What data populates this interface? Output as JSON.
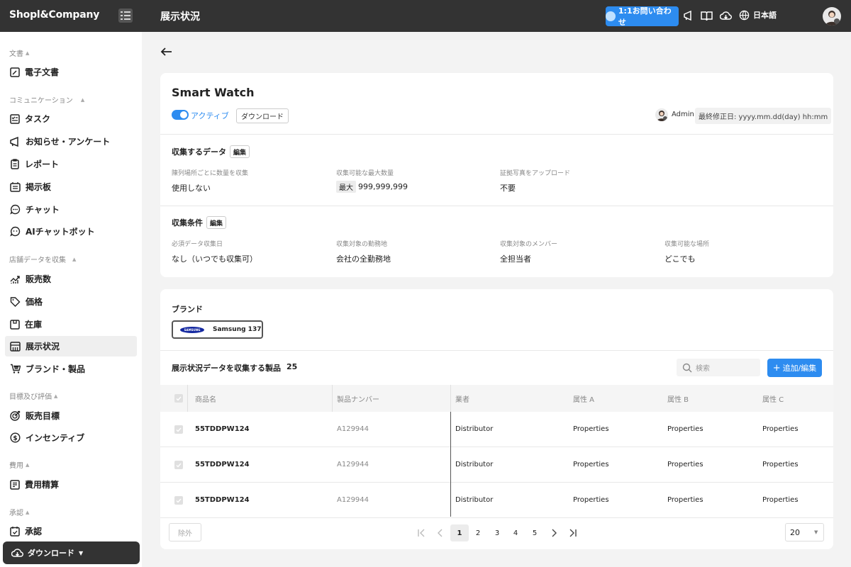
{
  "topbar": {
    "logo": "Shopl&Company",
    "page_title": "展示状況",
    "contact_label": "1:1お問い合わせ",
    "language": "日本語"
  },
  "sidebar": {
    "sections": {
      "documents": "文書",
      "communication": "コミュニケーション",
      "store_data": "店舗データを収集",
      "goals": "目標及び評価",
      "expenses": "費用",
      "approval": "承認"
    },
    "items": {
      "e_document": "電子文書",
      "task": "タスク",
      "notice": "お知らせ・アンケート",
      "report": "レポート",
      "board": "掲示板",
      "chat": "チャット",
      "ai_chatbot": "AIチャットボット",
      "sales": "販売数",
      "price": "価格",
      "stock": "在庫",
      "display": "展示状況",
      "brand_product": "ブランド・製品",
      "sales_target": "販売目標",
      "incentive": "インセンティブ",
      "expense_settle": "費用精算",
      "approval": "承認"
    },
    "download_label": "ダウンロード"
  },
  "detail": {
    "title": "Smart Watch",
    "status": "アクティブ",
    "download_btn": "ダウンロード",
    "admin_name": "Admin",
    "modified": "最終修正日: yyyy.mm.dd(day) hh:mm",
    "collect_data": {
      "title": "収集するデータ",
      "edit": "編集",
      "fields": [
        {
          "label": "陳列場所ごとに数量を収集",
          "value": "使用しない"
        },
        {
          "label": "収集可能な最大数量",
          "tag": "最大",
          "value": "999,999,999"
        },
        {
          "label": "証拠写真をアップロード",
          "value": "不要"
        }
      ]
    },
    "conditions": {
      "title": "収集条件",
      "edit": "編集",
      "fields": [
        {
          "label": "必須データ収集日",
          "value": "なし（いつでも収集可）"
        },
        {
          "label": "収集対象の勤務地",
          "value": "会社の全勤務地"
        },
        {
          "label": "収集対象のメンバー",
          "value": "全担当者"
        },
        {
          "label": "収集可能な場所",
          "value": "どこでも"
        }
      ]
    }
  },
  "products": {
    "brand_title": "ブランド",
    "brand_chip": "Samsung 137",
    "brand_logo_text": "SAMSUNG",
    "list_title": "展示状況データを収集する製品",
    "count": "25",
    "search_placeholder": "検索",
    "add_btn": "追加/編集",
    "columns": [
      "商品名",
      "製品ナンバー",
      "業者",
      "属性 A",
      "属性 B",
      "属性 C"
    ],
    "rows": [
      [
        "55TDDPW124",
        "A129944",
        "Distributor",
        "Properties",
        "Properties",
        "Properties"
      ],
      [
        "55TDDPW124",
        "A129944",
        "Distributor",
        "Properties",
        "Properties",
        "Properties"
      ],
      [
        "55TDDPW124",
        "A129944",
        "Distributor",
        "Properties",
        "Properties",
        "Properties"
      ]
    ],
    "exclude_btn": "除外",
    "pages": [
      "1",
      "2",
      "3",
      "4",
      "5"
    ],
    "current_page": "1",
    "per_page": "20"
  }
}
